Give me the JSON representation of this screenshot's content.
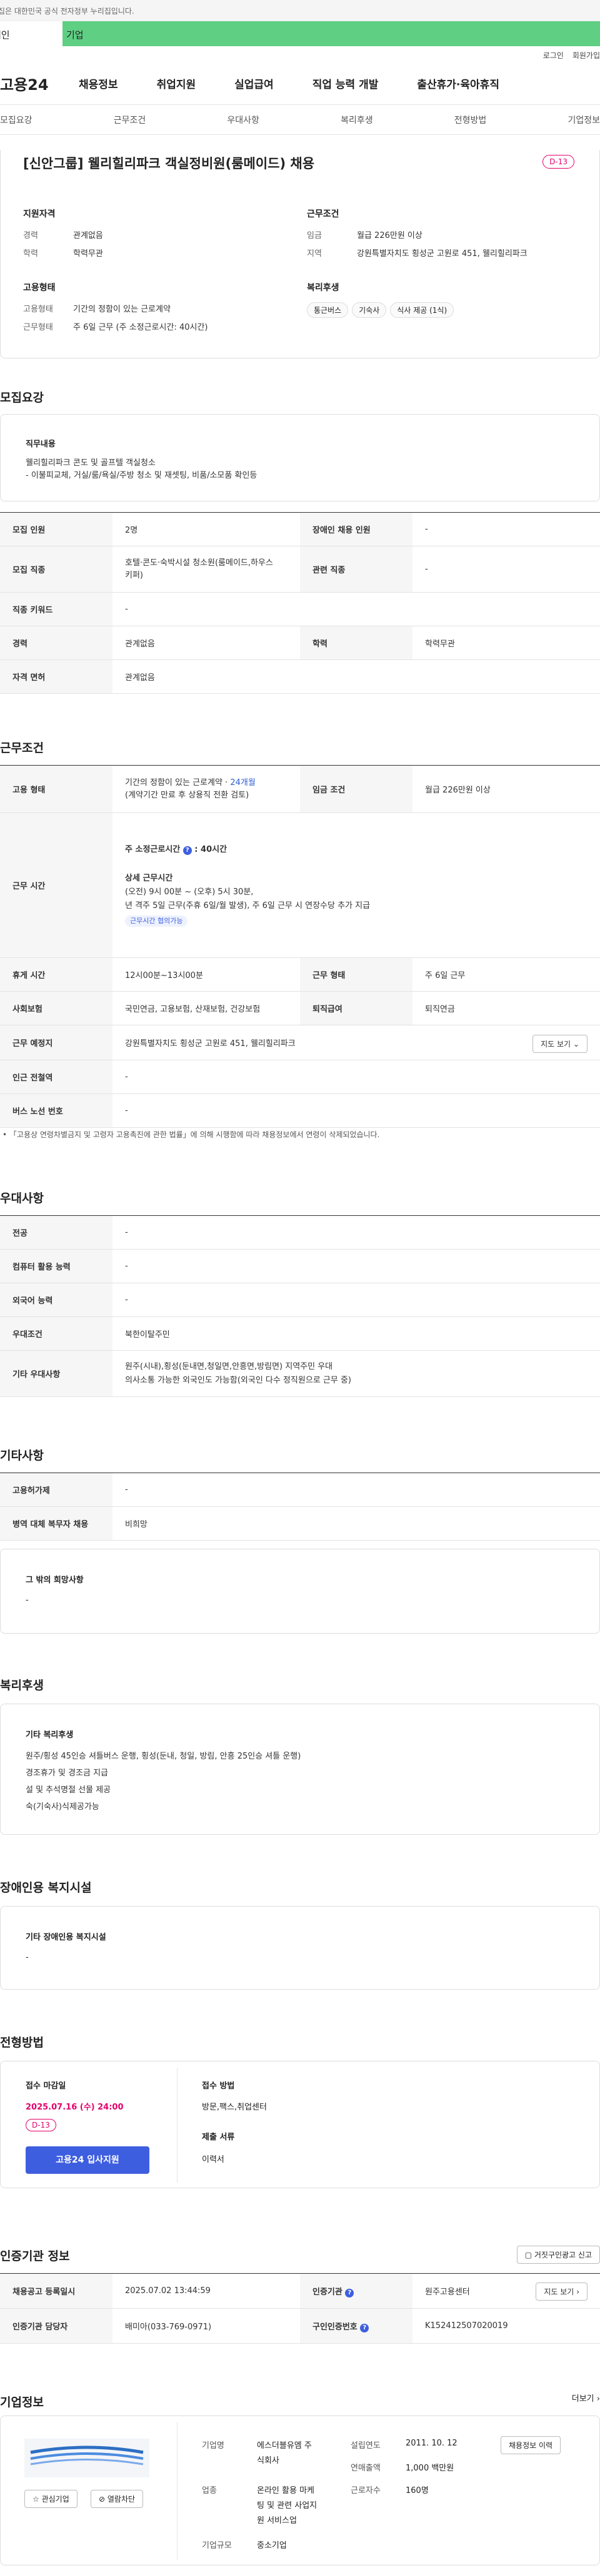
{
  "gov_banner": "이 누리집은 대한민국 공식 전자정부 누리집입니다.",
  "toptabs": {
    "left": "개인",
    "right": "기업"
  },
  "util": [
    "로그인",
    "회원가입"
  ],
  "gnb": {
    "logo": "고용24",
    "menu": [
      "채용정보",
      "취업지원",
      "실업급여",
      "직업 능력 개발",
      "출산휴가·육아휴직"
    ]
  },
  "subnav": [
    "모집요강",
    "근무조건",
    "우대사항",
    "복리후생",
    "전형방법",
    "기업정보"
  ],
  "job": {
    "title": "[신안그룹] 웰리힐리파크 객실정비원(룸메이드) 채용",
    "dday": "D-13",
    "qual_h": "지원자격",
    "exp_k": "경력",
    "exp_v": "관계없음",
    "edu_k": "학력",
    "edu_v": "학력무관",
    "cond_h": "근무조건",
    "wage_k": "임금",
    "wage_v": "월급 226만원 이상",
    "area_k": "지역",
    "area_v": "강원특별자치도 횡성군 고원로 451, 웰리힐리파크",
    "emp_h": "고용형태",
    "type_k": "고용형태",
    "type_v": "기간의 정함이 있는 근로계약",
    "form_k": "근무형태",
    "form_v": "주 6일 근무 (주 소정근로시간: 40시간)",
    "welfare_h": "복리후생",
    "tags": [
      "통근버스",
      "기숙사",
      "식사 제공 (1식)"
    ]
  },
  "recruit": {
    "title": "모집요강",
    "duty_h": "직무내용",
    "duty_lines": [
      "웰리힐리파크 콘도 및 골프텔 객실청소",
      "- 이불피교체, 거실/룸/욕실/주방 청소 및 재셋팅, 비품/소모품 확인등"
    ],
    "rows": [
      [
        "모집 인원",
        "2명",
        "장애인 채용 인원",
        "-"
      ],
      [
        "모집 직종",
        "호텔·콘도·숙박시설 청소원(룸메이드,하우스키퍼)",
        "관련 직종",
        "-"
      ],
      [
        "직종 키워드",
        "-"
      ],
      [
        "경력",
        "관계없음",
        "학력",
        "학력무관"
      ],
      [
        "자격 면허",
        "관계없음"
      ]
    ]
  },
  "work": {
    "title": "근무조건",
    "r1": [
      "고용 형태",
      "기간의 정함이 있는 근로계약 · ",
      "24개월",
      "(계약기간 만료 후 상용직 전환 검토)",
      "임금 조건",
      "월급 226만원 이상"
    ],
    "hours_k": "근무 시간",
    "hours_main_a": "주 소정근로시간",
    "hours_main_b": "40시간",
    "hours_sub": "상세 근무시간",
    "hours_l1": "(오전) 9시 00분 ~ (오후) 5시 30분,",
    "hours_l2": "년 격주 5일 근무(주휴 6일/월 발생), 주 6일 근무 시 연장수당 추가 지급",
    "hours_badge": "근무시간 협의가능",
    "r3": [
      "휴게 시간",
      "12시00분~13시00분",
      "근무 형태",
      "주 6일 근무"
    ],
    "r4": [
      "사회보험",
      "국민연금, 고용보험, 산재보험, 건강보험",
      "퇴직급여",
      "퇴직연금"
    ],
    "r5": [
      "근무 예정지",
      "강원특별자치도 횡성군 고원로 451, 웰리힐리파크",
      "지도 보기"
    ],
    "r6": [
      "인근 전철역",
      "-"
    ],
    "r7": [
      "버스 노선 번호",
      "-"
    ],
    "note": "「고용상 연령차별금지 및 고령자 고용촉진에 관한 법률」에 의해 시행함에 따라 채용정보에서 연령이 삭제되었습니다."
  },
  "pref": {
    "title": "우대사항",
    "rows": [
      [
        "전공",
        "-"
      ],
      [
        "컴퓨터 활용 능력",
        "-"
      ],
      [
        "외국어 능력",
        "-"
      ],
      [
        "우대조건",
        "북한이탈주민"
      ],
      [
        "기타 우대사항",
        "원주(시내),횡성(둔내면,청일면,안흥면,방림면) 지역주민 우대",
        "의사소통 가능한 외국인도 가능함(외국인 다수 정직원으로 근무 중)"
      ]
    ]
  },
  "etc": {
    "title": "기타사항",
    "rows": [
      [
        "고용허가제",
        "-"
      ],
      [
        "병역 대체 복무자 채용",
        "비희망"
      ]
    ],
    "other_h": "그 밖의 희망사항",
    "other_v": "-"
  },
  "benefit": {
    "title": "복리후생",
    "h": "기타 복리후생",
    "lines": [
      "원주/횡성 45인승 셔틀버스 운행, 횡성(둔내, 청일, 방림, 안흥 25인승 셔틀 운행)",
      "경조휴가 및 경조금 지급",
      "설 및 추석명절 선물 제공",
      "숙(기숙사)식제공가능"
    ]
  },
  "disab": {
    "title": "장애인용 복지시설",
    "h": "기타 장애인용 복지시설",
    "v": "-"
  },
  "proc": {
    "title": "전형방법",
    "deadline_h": "접수 마감일",
    "deadline_v": "2025.07.16 (수) 24:00",
    "dday": "D-13",
    "apply": "고용24 입사지원",
    "method_h": "접수 방법",
    "method_v": "방문,팩스,취업센터",
    "docs_h": "제출 서류",
    "docs_v": "이력서"
  },
  "cert": {
    "title": "인증기관 정보",
    "fakebtn": "거짓구인광고 신고",
    "r1": [
      "채용공고 등록일시",
      "2025.07.02 13:44:59",
      "인증기관",
      "원주고용센터",
      "지도 보기"
    ],
    "r2": [
      "인증기관 담당자",
      "배미아(033-769-0971)",
      "구인인증번호",
      "K152412507020019"
    ]
  },
  "company": {
    "title": "기업정보",
    "more": "더보기",
    "fav": "관심기업",
    "block": "열람차단",
    "name_k": "기업명",
    "name_v": [
      "에스더블유엠 주",
      "식회사"
    ],
    "ind_k": "업종",
    "ind_v": [
      "온라인 활용 마케",
      "팅 및 관련 사업지",
      "원 서비스업"
    ],
    "size_k": "기업규모",
    "size_v": "중소기업",
    "est_k": "설립연도",
    "est_v": "2011. 10. 12",
    "rev_k": "연매출액",
    "rev_v": "1,000 백만원",
    "emp_k": "근로자수",
    "emp_v": "160명",
    "jobsbtn": "채용정보 이력"
  }
}
